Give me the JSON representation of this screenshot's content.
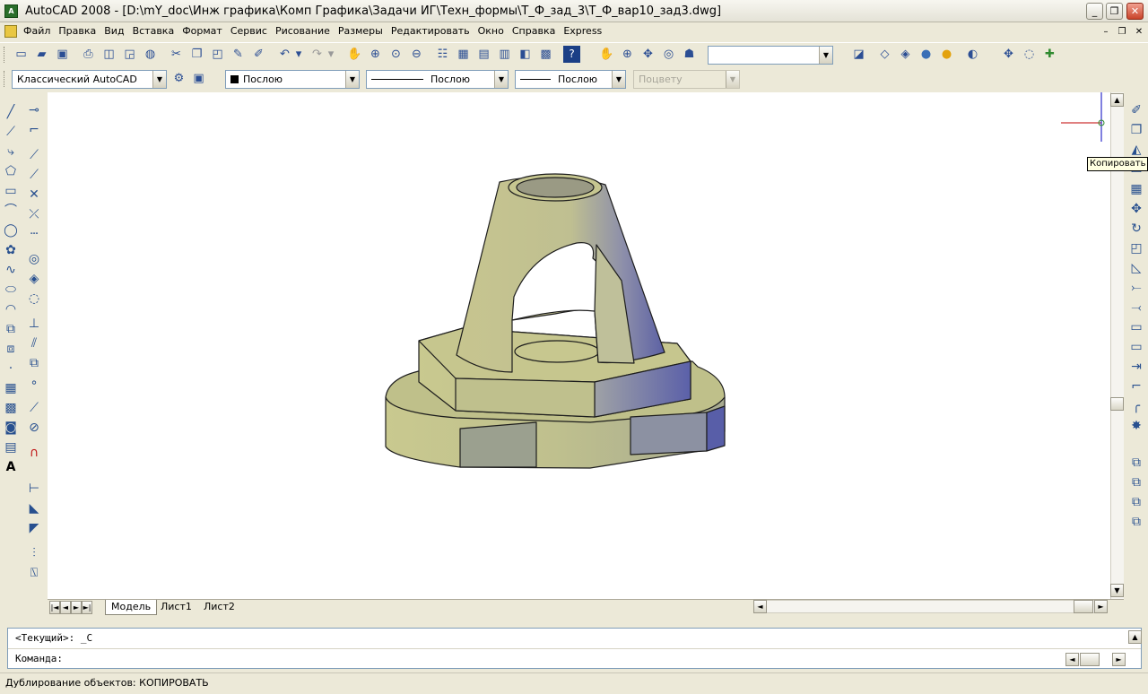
{
  "window": {
    "title": "AutoCAD 2008 - [D:\\mY_doc\\Инж графика\\Комп Графика\\Задачи ИГ\\Техн_формы\\Т_Ф_зад_3\\Т_Ф_вар10_зад3.dwg]",
    "minimize": "_",
    "restore": "❐",
    "close": "✕"
  },
  "menu": {
    "items": [
      "Файл",
      "Правка",
      "Вид",
      "Вставка",
      "Формат",
      "Сервис",
      "Рисование",
      "Размеры",
      "Редактировать",
      "Окно",
      "Справка",
      "Express"
    ],
    "doc_minimize": "–",
    "doc_restore": "❐",
    "doc_close": "✕"
  },
  "toolbar1": {
    "icons": [
      "new",
      "open",
      "save",
      "plot",
      "preview",
      "publish",
      "3d-dwf",
      "cut",
      "copy",
      "paste",
      "match",
      "undo",
      "undo-list",
      "redo",
      "redo-list",
      "pan",
      "zoom-realtime",
      "zoom-window",
      "zoom-previous",
      "properties",
      "design-center",
      "tool-palettes",
      "sheet-set",
      "markup",
      "calc",
      "help",
      "pan-rt",
      "zoom",
      "orbit",
      "steeringwheel",
      "walk",
      "light",
      "visual-style",
      "wire",
      "hide",
      "realistic",
      "materials",
      "layer"
    ],
    "named_view": ""
  },
  "toolbar2": {
    "workspace": "Классический AutoCAD",
    "color": "Послою",
    "linetype": "Послою",
    "lineweight": "Послою",
    "plotstyle": "Поцвету"
  },
  "tabs": [
    "Модель",
    "Лист1",
    "Лист2"
  ],
  "command": {
    "history": "<Текущий>:  _C",
    "prompt": "Команда:"
  },
  "status": "Дублирование объектов: КОПИРОВАТЬ",
  "tooltip": "Копировать",
  "scroll": {
    "up": "▲",
    "down": "▼",
    "left": "◄",
    "right": "►"
  },
  "colors": {
    "solid": "#c7c58d",
    "shade": "#6a6fa7",
    "dark": "#8d9378",
    "ucs_x": "#c00000",
    "ucs_y": "#0000c0"
  }
}
